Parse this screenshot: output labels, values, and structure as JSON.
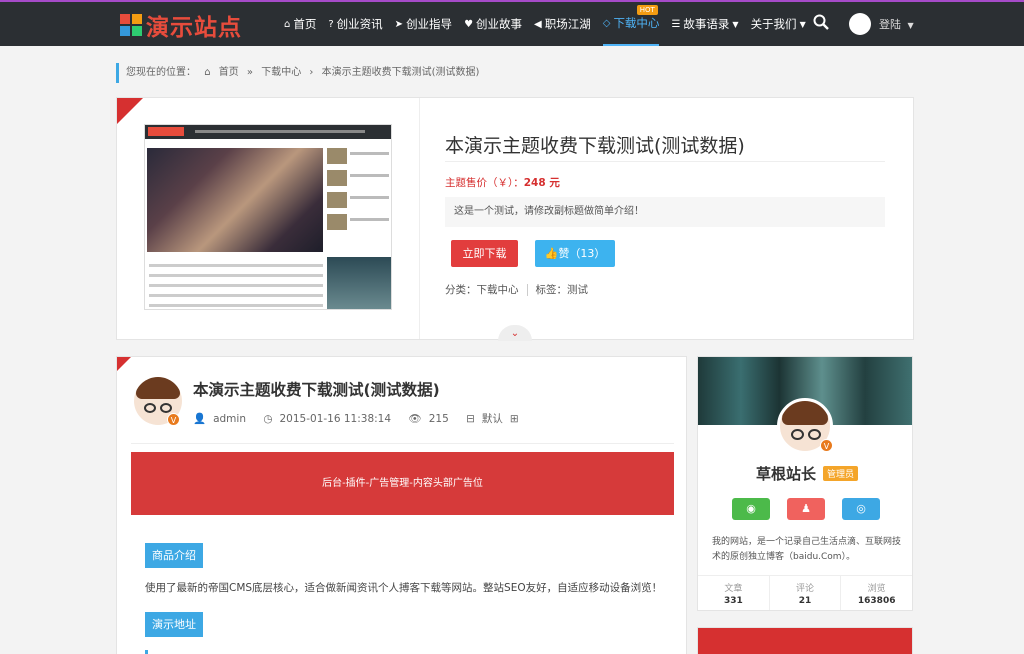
{
  "header": {
    "logo_text": "演示站点",
    "nav": [
      {
        "label": "首页",
        "icon": "home-icon",
        "glyph": "⌂"
      },
      {
        "label": "创业资讯",
        "icon": "question-icon",
        "glyph": "?"
      },
      {
        "label": "创业指导",
        "icon": "paper-plane-icon",
        "glyph": "➤"
      },
      {
        "label": "创业故事",
        "icon": "heart-icon",
        "glyph": "♥"
      },
      {
        "label": "职场江湖",
        "icon": "bullhorn-icon",
        "glyph": "◀"
      },
      {
        "label": "下载中心",
        "icon": "diamond-icon",
        "glyph": "◇"
      },
      {
        "label": "故事语录",
        "icon": "list-icon",
        "glyph": "☰"
      },
      {
        "label": "关于我们",
        "icon": "",
        "glyph": ""
      }
    ],
    "hot_badge": "HOT",
    "login": "登陆"
  },
  "breadcrumb": {
    "prefix": "您现在的位置：",
    "home": "首页",
    "category": "下载中心",
    "current": "本演示主题收费下载测试(测试数据)"
  },
  "product": {
    "title": "本演示主题收费下载测试(测试数据)",
    "price_label": "主题售价（￥）：",
    "price_value": "248 元",
    "description": "这是一个测试，请修改副标题做简单介绍！",
    "download_label": "立即下载",
    "like_label": "赞（13）",
    "category_label": "分类：下载中心",
    "tag_label": "标签：测试"
  },
  "article": {
    "title": "本演示主题收费下载测试(测试数据)",
    "author": "admin",
    "datetime": "2015-01-16 11:38:14",
    "views": "215",
    "default_label": "默认",
    "ad_text": "后台-插件-广告管理-内容头部广告位",
    "section_intro": "商品介绍",
    "intro_text": "使用了最新的帝国CMS底层核心，适合做新闻资讯个人搏客下载等网站。整站SEO友好，自适应移动设备浏览！",
    "section_demo": "演示地址"
  },
  "profile": {
    "name": "草根站长",
    "badge": "管理员",
    "bio": "我的网站，是一个记录自己生活点滴、互联网技术的原创独立博客（baidu.Com）。",
    "stats": [
      {
        "label": "文章",
        "value": "331"
      },
      {
        "label": "评论",
        "value": "21"
      },
      {
        "label": "浏览",
        "value": "163806"
      }
    ]
  },
  "colors": {
    "accent_red": "#d63030",
    "accent_blue": "#3da8e4",
    "header_bg": "#2b2f33"
  }
}
